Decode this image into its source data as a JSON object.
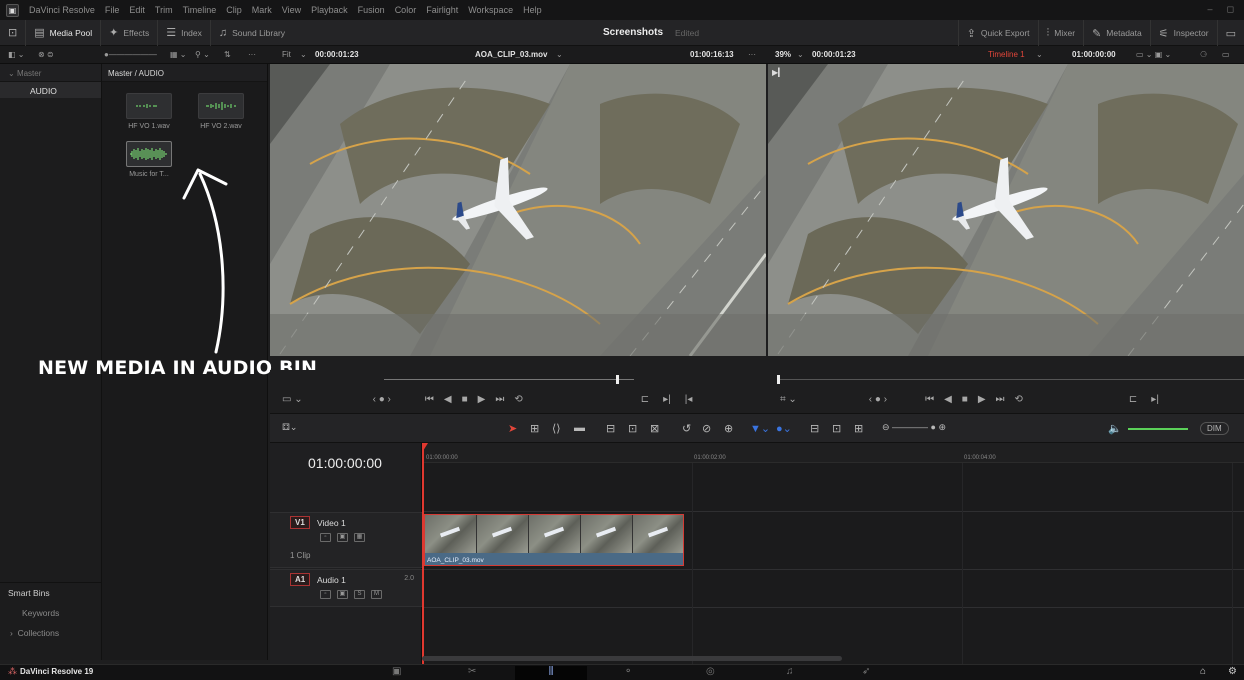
{
  "menubar": {
    "app_name": "DaVinci Resolve",
    "items": [
      "File",
      "Edit",
      "Trim",
      "Timeline",
      "Clip",
      "Mark",
      "View",
      "Playback",
      "Fusion",
      "Color",
      "Fairlight",
      "Workspace",
      "Help"
    ]
  },
  "toolbar": {
    "media_pool": "Media Pool",
    "effects": "Effects",
    "index": "Index",
    "sound_library": "Sound Library",
    "project_title": "Screenshots",
    "project_status": "Edited",
    "quick_export": "Quick Export",
    "mixer": "Mixer",
    "metadata": "Metadata",
    "inspector": "Inspector"
  },
  "subbar": {
    "fit": "Fit",
    "source_timecode": "00:00:01:23",
    "clip_name": "AOA_CLIP_03.mov",
    "source_duration": "01:00:16:13",
    "zoom": "39%",
    "record_timecode": "00:00:01:23",
    "timeline_name": "Timeline 1",
    "timeline_tc": "01:00:00:00"
  },
  "bins": {
    "header": "Master",
    "items": [
      "AUDIO"
    ],
    "smart_bins": "Smart Bins",
    "keywords": "Keywords",
    "collections": "Collections"
  },
  "media": {
    "path": "Master / AUDIO",
    "clips": [
      {
        "name": "HF VO 1.wav"
      },
      {
        "name": "HF VO 2.wav"
      },
      {
        "name": "Music for T..."
      }
    ]
  },
  "annotation": "NEW MEDIA IN AUDIO BIN",
  "timeline": {
    "timecode": "01:00:00:00",
    "ruler": [
      "01:00:00:00",
      "01:00:02:00",
      "01:00:04:00"
    ],
    "video_track": {
      "tag": "V1",
      "name": "Video 1",
      "clip_count": "1 Clip"
    },
    "audio_track": {
      "tag": "A1",
      "name": "Audio 1",
      "channels": "2.0"
    },
    "clip_name": "AOA_CLIP_03.mov",
    "dim": "DIM"
  },
  "pagebar": {
    "brand": "DaVinci Resolve 19"
  },
  "colors": {
    "accent_red": "#e2463a",
    "clip_blue": "#4a6a86",
    "playhead": "#e0382f"
  }
}
